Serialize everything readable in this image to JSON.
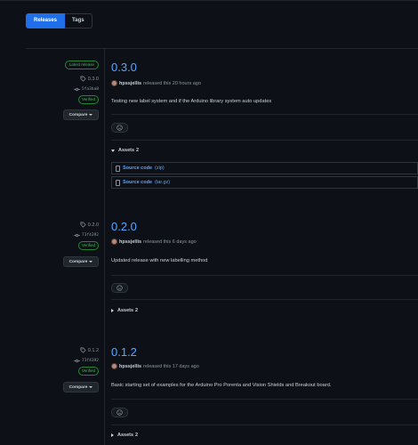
{
  "tabs": [
    {
      "label": "Releases",
      "active": true
    },
    {
      "label": "Tags",
      "active": false
    }
  ],
  "colors": {
    "accent": "#1f6feb",
    "link": "#58a6ff",
    "verified": "#3fb950",
    "bg": "#0d1117",
    "border": "#30363d"
  },
  "releases": [
    {
      "latest_badge": "Latest release",
      "tag": "0.3.0",
      "commit": "5fa3ba8",
      "verified": "Verified",
      "compare": "Compare",
      "version": "0.3.0",
      "author": "hpssjellis",
      "released_text": "released this 20 hours ago",
      "description": "Testing new label system and if the Arduino library system auto updates",
      "assets_label": "Assets",
      "assets_count": "2",
      "assets_expanded": true,
      "assets": [
        {
          "name": "Source code",
          "kind": "(zip)"
        },
        {
          "name": "Source code",
          "kind": "(tar.gz)"
        }
      ]
    },
    {
      "tag": "0.2.0",
      "commit": "73f4392",
      "verified": "Verified",
      "compare": "Compare",
      "version": "0.2.0",
      "author": "hpssjellis",
      "released_text": "released this 6 days ago",
      "description": "Updated release with new labelling method",
      "assets_label": "Assets",
      "assets_count": "2",
      "assets_expanded": false
    },
    {
      "tag": "0.1.2",
      "commit": "73f4392",
      "verified": "Verified",
      "compare": "Compare",
      "version": "0.1.2",
      "author": "hpssjellis",
      "released_text": "released this 17 days ago",
      "description": "Basic starting set of examples for the Arduino Pro Porenta and Vision Shields and Breakout board.",
      "assets_label": "Assets",
      "assets_count": "2",
      "assets_expanded": false
    }
  ]
}
